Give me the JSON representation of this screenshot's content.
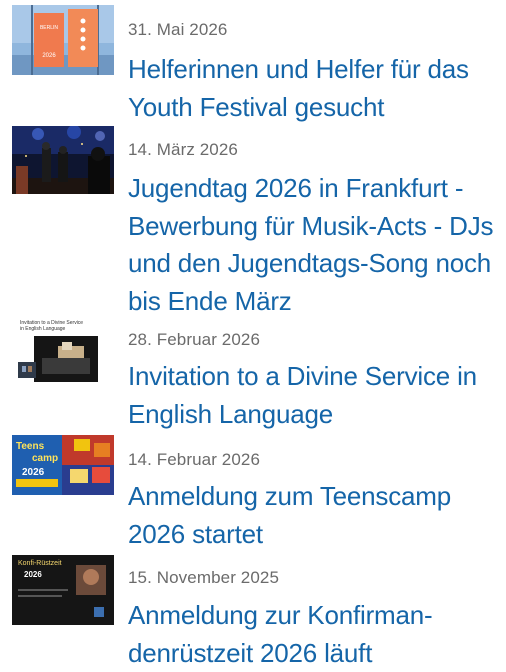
{
  "news": [
    {
      "date": "31. Mai 2026",
      "title": "Helferinnen und Helfer für das Youth Festival gesucht",
      "thumbnail_text": [
        "BERLIN",
        "2026"
      ]
    },
    {
      "date": "14. März 2026",
      "title": "Jugendtag 2026 in Frankfurt - Bewerbung für Musik-Acts - DJs und den Jugendtags-Song noch bis Ende März"
    },
    {
      "date": "28. Februar 2026",
      "title": "Invitation to a Divine Service in English Language",
      "thumbnail_text": [
        "Invitation to a Divine Service",
        "in English Language"
      ]
    },
    {
      "date": "14. Februar 2026",
      "title": "Anmeldung zum Teenscamp 2026 startet",
      "thumbnail_text": [
        "Teens",
        "camp",
        "2026"
      ]
    },
    {
      "date": "15. November 2025",
      "title": "Anmeldung zur Konfirman­denrüstzeit 2026 läuft",
      "thumbnail_text": [
        "Konfi-Rüstzeit",
        "2026"
      ]
    }
  ],
  "colors": {
    "title": "#1565a8",
    "date": "#6b6b6b"
  }
}
